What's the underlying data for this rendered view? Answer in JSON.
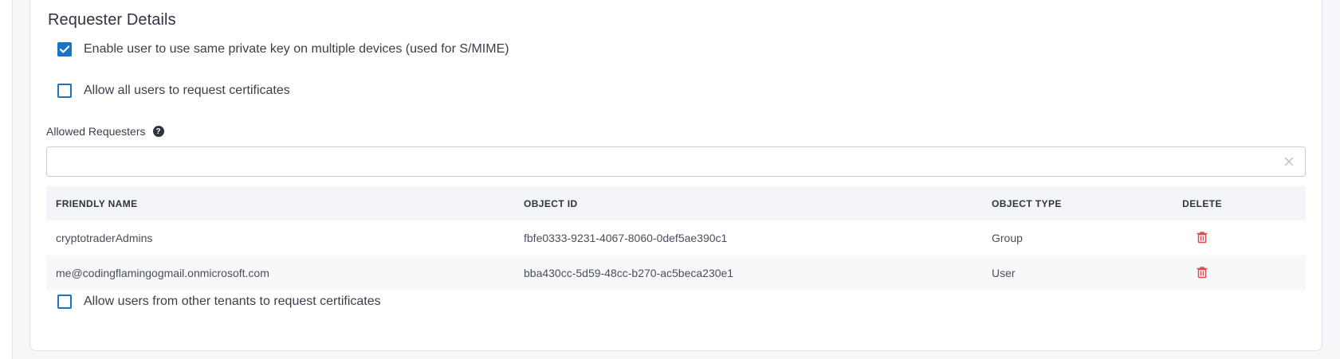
{
  "section": {
    "title": "Requester Details"
  },
  "options": {
    "same_private_key": {
      "label": "Enable user to use same private key on multiple devices (used for S/MIME)",
      "checked": true
    },
    "allow_all_users": {
      "label": "Allow all users to request certificates",
      "checked": false
    },
    "allow_other_tenants": {
      "label": "Allow users from other tenants to request certificates",
      "checked": false
    }
  },
  "allowed_requesters": {
    "label": "Allowed Requesters",
    "value": ""
  },
  "table": {
    "headers": {
      "friendly_name": "FRIENDLY NAME",
      "object_id": "OBJECT ID",
      "object_type": "OBJECT TYPE",
      "delete": "DELETE"
    },
    "rows": [
      {
        "friendly_name": "cryptotraderAdmins",
        "object_id": "fbfe0333-9231-4067-8060-0def5ae390c1",
        "object_type": "Group"
      },
      {
        "friendly_name": "me@codingflamingogmail.onmicrosoft.com",
        "object_id": "bba430cc-5d59-48cc-b270-ac5beca230e1",
        "object_type": "User"
      }
    ]
  },
  "colors": {
    "accent": "#1b73c7",
    "delete": "#e0474c"
  },
  "icons": {
    "checkbox_checked": "checkmark-icon",
    "help": "question-circle-icon",
    "clear": "close-icon",
    "delete": "trash-icon"
  }
}
